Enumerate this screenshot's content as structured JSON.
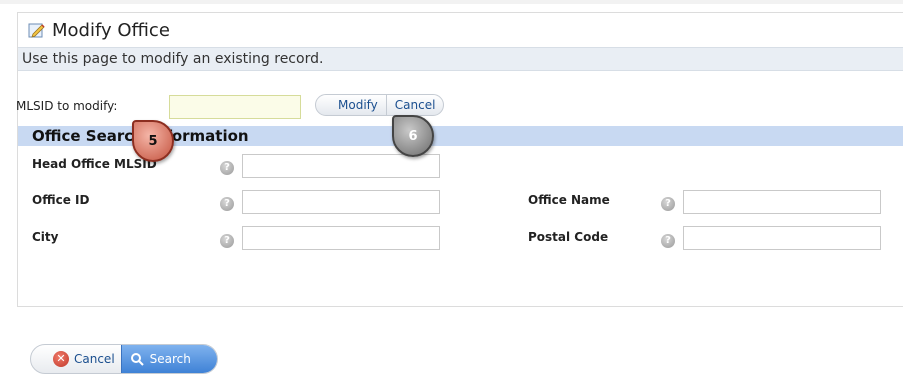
{
  "page": {
    "title": "Modify Office",
    "description": "Use this page to modify an existing record."
  },
  "modify_form": {
    "mlsid_label": "MLSID to modify:",
    "mlsid_value": "",
    "modify_label": "Modify",
    "cancel_label": "Cancel"
  },
  "section": {
    "title": "Office Search Information",
    "fields": [
      {
        "label": "Head Office MLSID",
        "value": ""
      },
      {
        "label": "Office ID",
        "value": ""
      },
      {
        "label": "Office Name",
        "value": ""
      },
      {
        "label": "City",
        "value": ""
      },
      {
        "label": "Postal Code",
        "value": ""
      }
    ],
    "help_glyph": "?"
  },
  "callouts": [
    "5",
    "6"
  ],
  "bottom": {
    "cancel_label": "Cancel",
    "search_label": "Search"
  },
  "colors": {
    "section_head_bg": "#c8d9f2",
    "search_button": "#3f82d6",
    "callout_5": "#c4533f",
    "callout_6": "#6c6c6c"
  },
  "icons": [
    "edit-note-icon",
    "help-icon",
    "cancel-x-icon",
    "search-magnifier-icon"
  ]
}
